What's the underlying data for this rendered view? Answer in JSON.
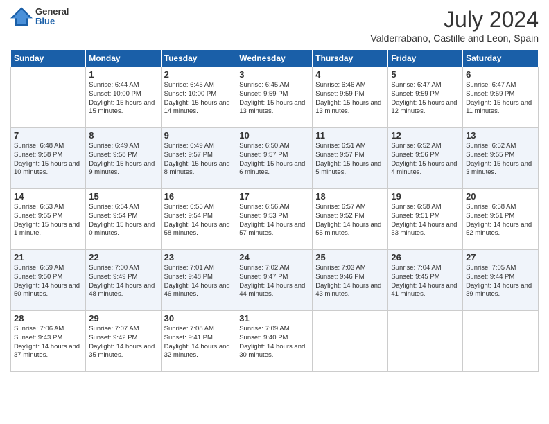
{
  "header": {
    "logo": {
      "general": "General",
      "blue": "Blue"
    },
    "title": "July 2024",
    "location": "Valderrabano, Castille and Leon, Spain"
  },
  "weekdays": [
    "Sunday",
    "Monday",
    "Tuesday",
    "Wednesday",
    "Thursday",
    "Friday",
    "Saturday"
  ],
  "weeks": [
    [
      {
        "day": "",
        "info": ""
      },
      {
        "day": "1",
        "info": "Sunrise: 6:44 AM\nSunset: 10:00 PM\nDaylight: 15 hours\nand 15 minutes."
      },
      {
        "day": "2",
        "info": "Sunrise: 6:45 AM\nSunset: 10:00 PM\nDaylight: 15 hours\nand 14 minutes."
      },
      {
        "day": "3",
        "info": "Sunrise: 6:45 AM\nSunset: 9:59 PM\nDaylight: 15 hours\nand 13 minutes."
      },
      {
        "day": "4",
        "info": "Sunrise: 6:46 AM\nSunset: 9:59 PM\nDaylight: 15 hours\nand 13 minutes."
      },
      {
        "day": "5",
        "info": "Sunrise: 6:47 AM\nSunset: 9:59 PM\nDaylight: 15 hours\nand 12 minutes."
      },
      {
        "day": "6",
        "info": "Sunrise: 6:47 AM\nSunset: 9:59 PM\nDaylight: 15 hours\nand 11 minutes."
      }
    ],
    [
      {
        "day": "7",
        "info": "Sunrise: 6:48 AM\nSunset: 9:58 PM\nDaylight: 15 hours\nand 10 minutes."
      },
      {
        "day": "8",
        "info": "Sunrise: 6:49 AM\nSunset: 9:58 PM\nDaylight: 15 hours\nand 9 minutes."
      },
      {
        "day": "9",
        "info": "Sunrise: 6:49 AM\nSunset: 9:57 PM\nDaylight: 15 hours\nand 8 minutes."
      },
      {
        "day": "10",
        "info": "Sunrise: 6:50 AM\nSunset: 9:57 PM\nDaylight: 15 hours\nand 6 minutes."
      },
      {
        "day": "11",
        "info": "Sunrise: 6:51 AM\nSunset: 9:57 PM\nDaylight: 15 hours\nand 5 minutes."
      },
      {
        "day": "12",
        "info": "Sunrise: 6:52 AM\nSunset: 9:56 PM\nDaylight: 15 hours\nand 4 minutes."
      },
      {
        "day": "13",
        "info": "Sunrise: 6:52 AM\nSunset: 9:55 PM\nDaylight: 15 hours\nand 3 minutes."
      }
    ],
    [
      {
        "day": "14",
        "info": "Sunrise: 6:53 AM\nSunset: 9:55 PM\nDaylight: 15 hours\nand 1 minute."
      },
      {
        "day": "15",
        "info": "Sunrise: 6:54 AM\nSunset: 9:54 PM\nDaylight: 15 hours\nand 0 minutes."
      },
      {
        "day": "16",
        "info": "Sunrise: 6:55 AM\nSunset: 9:54 PM\nDaylight: 14 hours\nand 58 minutes."
      },
      {
        "day": "17",
        "info": "Sunrise: 6:56 AM\nSunset: 9:53 PM\nDaylight: 14 hours\nand 57 minutes."
      },
      {
        "day": "18",
        "info": "Sunrise: 6:57 AM\nSunset: 9:52 PM\nDaylight: 14 hours\nand 55 minutes."
      },
      {
        "day": "19",
        "info": "Sunrise: 6:58 AM\nSunset: 9:51 PM\nDaylight: 14 hours\nand 53 minutes."
      },
      {
        "day": "20",
        "info": "Sunrise: 6:58 AM\nSunset: 9:51 PM\nDaylight: 14 hours\nand 52 minutes."
      }
    ],
    [
      {
        "day": "21",
        "info": "Sunrise: 6:59 AM\nSunset: 9:50 PM\nDaylight: 14 hours\nand 50 minutes."
      },
      {
        "day": "22",
        "info": "Sunrise: 7:00 AM\nSunset: 9:49 PM\nDaylight: 14 hours\nand 48 minutes."
      },
      {
        "day": "23",
        "info": "Sunrise: 7:01 AM\nSunset: 9:48 PM\nDaylight: 14 hours\nand 46 minutes."
      },
      {
        "day": "24",
        "info": "Sunrise: 7:02 AM\nSunset: 9:47 PM\nDaylight: 14 hours\nand 44 minutes."
      },
      {
        "day": "25",
        "info": "Sunrise: 7:03 AM\nSunset: 9:46 PM\nDaylight: 14 hours\nand 43 minutes."
      },
      {
        "day": "26",
        "info": "Sunrise: 7:04 AM\nSunset: 9:45 PM\nDaylight: 14 hours\nand 41 minutes."
      },
      {
        "day": "27",
        "info": "Sunrise: 7:05 AM\nSunset: 9:44 PM\nDaylight: 14 hours\nand 39 minutes."
      }
    ],
    [
      {
        "day": "28",
        "info": "Sunrise: 7:06 AM\nSunset: 9:43 PM\nDaylight: 14 hours\nand 37 minutes."
      },
      {
        "day": "29",
        "info": "Sunrise: 7:07 AM\nSunset: 9:42 PM\nDaylight: 14 hours\nand 35 minutes."
      },
      {
        "day": "30",
        "info": "Sunrise: 7:08 AM\nSunset: 9:41 PM\nDaylight: 14 hours\nand 32 minutes."
      },
      {
        "day": "31",
        "info": "Sunrise: 7:09 AM\nSunset: 9:40 PM\nDaylight: 14 hours\nand 30 minutes."
      },
      {
        "day": "",
        "info": ""
      },
      {
        "day": "",
        "info": ""
      },
      {
        "day": "",
        "info": ""
      }
    ]
  ]
}
